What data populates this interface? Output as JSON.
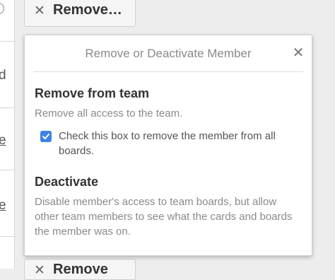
{
  "background_buttons": {
    "top_label": "Remove…",
    "bottom_label": "Remove",
    "remove_icon": "close-x-icon"
  },
  "left_column": {
    "chars": [
      "d",
      "e",
      "e"
    ]
  },
  "popover": {
    "title": "Remove or Deactivate Member",
    "close_icon": "close-x-icon",
    "sections": [
      {
        "title": "Remove from team",
        "description": "Remove all access to the team.",
        "option": {
          "checked": true,
          "label": "Check this box to remove the member from all boards."
        }
      },
      {
        "title": "Deactivate",
        "description": "Disable member's access to team boards, but allow other team members to see what the cards and boards the member was on."
      }
    ]
  },
  "colors": {
    "accent": "#3b83e6",
    "title_gray": "#8a8a8a"
  }
}
